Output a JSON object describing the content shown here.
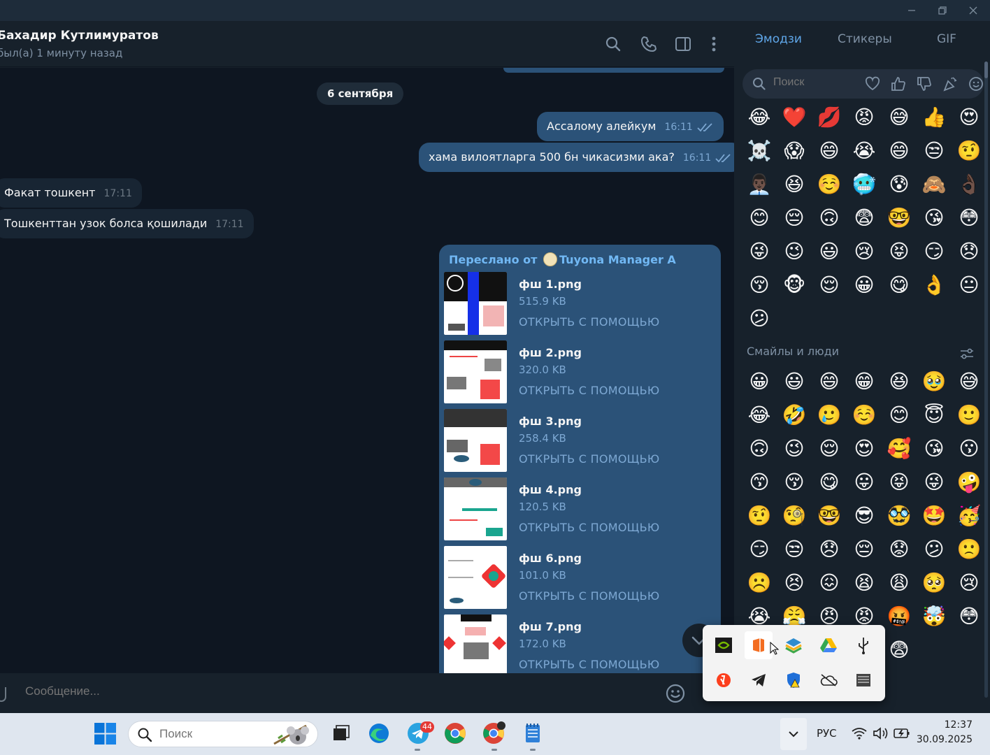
{
  "window": {
    "minimize": "—",
    "maximize": "❐",
    "close": "✕"
  },
  "chat": {
    "contact_name": "Бахадир Кутлимуратов",
    "contact_status": "был(а) 1 минуту назад",
    "date_separator": "6 сентября",
    "messages": [
      {
        "text": "Ассаломy алейкум",
        "time": "16:11",
        "direction": "out"
      },
      {
        "text": "хама вилоятларга 500 бн чикасизми ака?",
        "time": "16:11",
        "direction": "out"
      },
      {
        "text": "Факат тошкент",
        "time": "17:11",
        "direction": "in"
      },
      {
        "text": "Тошкенттан узок болса қошилади",
        "time": "17:11",
        "direction": "in"
      }
    ],
    "forwarded": {
      "label": "Переслано от",
      "source": "Tuyona Manager A",
      "files": [
        {
          "name": "фш 1.png",
          "size": "515.9 KB",
          "action": "ОТКРЫТЬ С ПОМОЩЬЮ"
        },
        {
          "name": "фш 2.png",
          "size": "320.0 KB",
          "action": "ОТКРЫТЬ С ПОМОЩЬЮ"
        },
        {
          "name": "фш 3.png",
          "size": "258.4 KB",
          "action": "ОТКРЫТЬ С ПОМОЩЬЮ"
        },
        {
          "name": "фш 4.png",
          "size": "120.5 KB",
          "action": "ОТКРЫТЬ С ПОМОЩЬЮ"
        },
        {
          "name": "фш 6.png",
          "size": "101.0 KB",
          "action": "ОТКРЫТЬ С ПОМОЩЬЮ"
        },
        {
          "name": "фш 7.png",
          "size": "172.0 KB",
          "action": "ОТКРЫТЬ С ПОМОЩЬЮ"
        }
      ]
    },
    "composer_placeholder": "Сообщение..."
  },
  "emoji_panel": {
    "tabs": [
      "Эмодзи",
      "Стикеры",
      "GIF"
    ],
    "active_tab": "Эмодзи",
    "search_placeholder": "Поиск",
    "recent": [
      "😂",
      "❤️",
      "💋",
      "😡",
      "😅",
      "👍",
      "😍",
      "☠️",
      "😱",
      "😄",
      "😭",
      "😄",
      "😒",
      "🤨",
      "👨🏿‍💼",
      "😆",
      "☺️",
      "🥶",
      "😰",
      "🙈",
      "👌🏿",
      "😊",
      "😔",
      "🙃",
      "😨",
      "🤓",
      "😘",
      "😳",
      "😜",
      "😉",
      "😃",
      "😢",
      "😝",
      "😏",
      "😞",
      "😚",
      "🐵",
      "😌",
      "😀",
      "😋",
      "👌",
      "😐",
      "😕"
    ],
    "section_title": "Смайлы и люди",
    "smileys": [
      "😀",
      "😃",
      "😄",
      "😁",
      "😆",
      "🥹",
      "😅",
      "😂",
      "🤣",
      "🥲",
      "☺️",
      "😊",
      "😇",
      "🙂",
      "🙃",
      "😉",
      "😌",
      "😍",
      "🥰",
      "😘",
      "😗",
      "😙",
      "😚",
      "😋",
      "😛",
      "😝",
      "😜",
      "🤪",
      "🤨",
      "🧐",
      "🤓",
      "😎",
      "🥸",
      "🤩",
      "🥳",
      "😏",
      "😒",
      "😞",
      "😔",
      "😟",
      "😕",
      "🙁",
      "☹️",
      "😣",
      "😖",
      "😫",
      "😩",
      "🥺",
      "😢",
      "😭",
      "😤",
      "😠",
      "😡",
      "🤬",
      "🤯",
      "😳",
      "🥵",
      "🥶",
      "😶‍🌫️",
      "😱",
      "😨"
    ]
  },
  "tray_popup": {
    "icons": [
      "nvidia-icon",
      "office-icon",
      "layers-app-icon",
      "google-drive-icon",
      "usb-icon",
      "yandex-icon",
      "telegram-icon",
      "defender-warning-icon",
      "onedrive-offline-icon",
      "device-manager-icon"
    ]
  },
  "taskbar": {
    "search_placeholder": "Поиск",
    "telegram_badge": "44",
    "language": "РУС",
    "time": "12:37",
    "date": "30.09.2025"
  },
  "colors": {
    "accent": "#5fa6e8",
    "out_bubble": "#2b5278",
    "in_bubble": "#182533",
    "chat_bg": "#0e1621",
    "panel_bg": "#17212b"
  }
}
